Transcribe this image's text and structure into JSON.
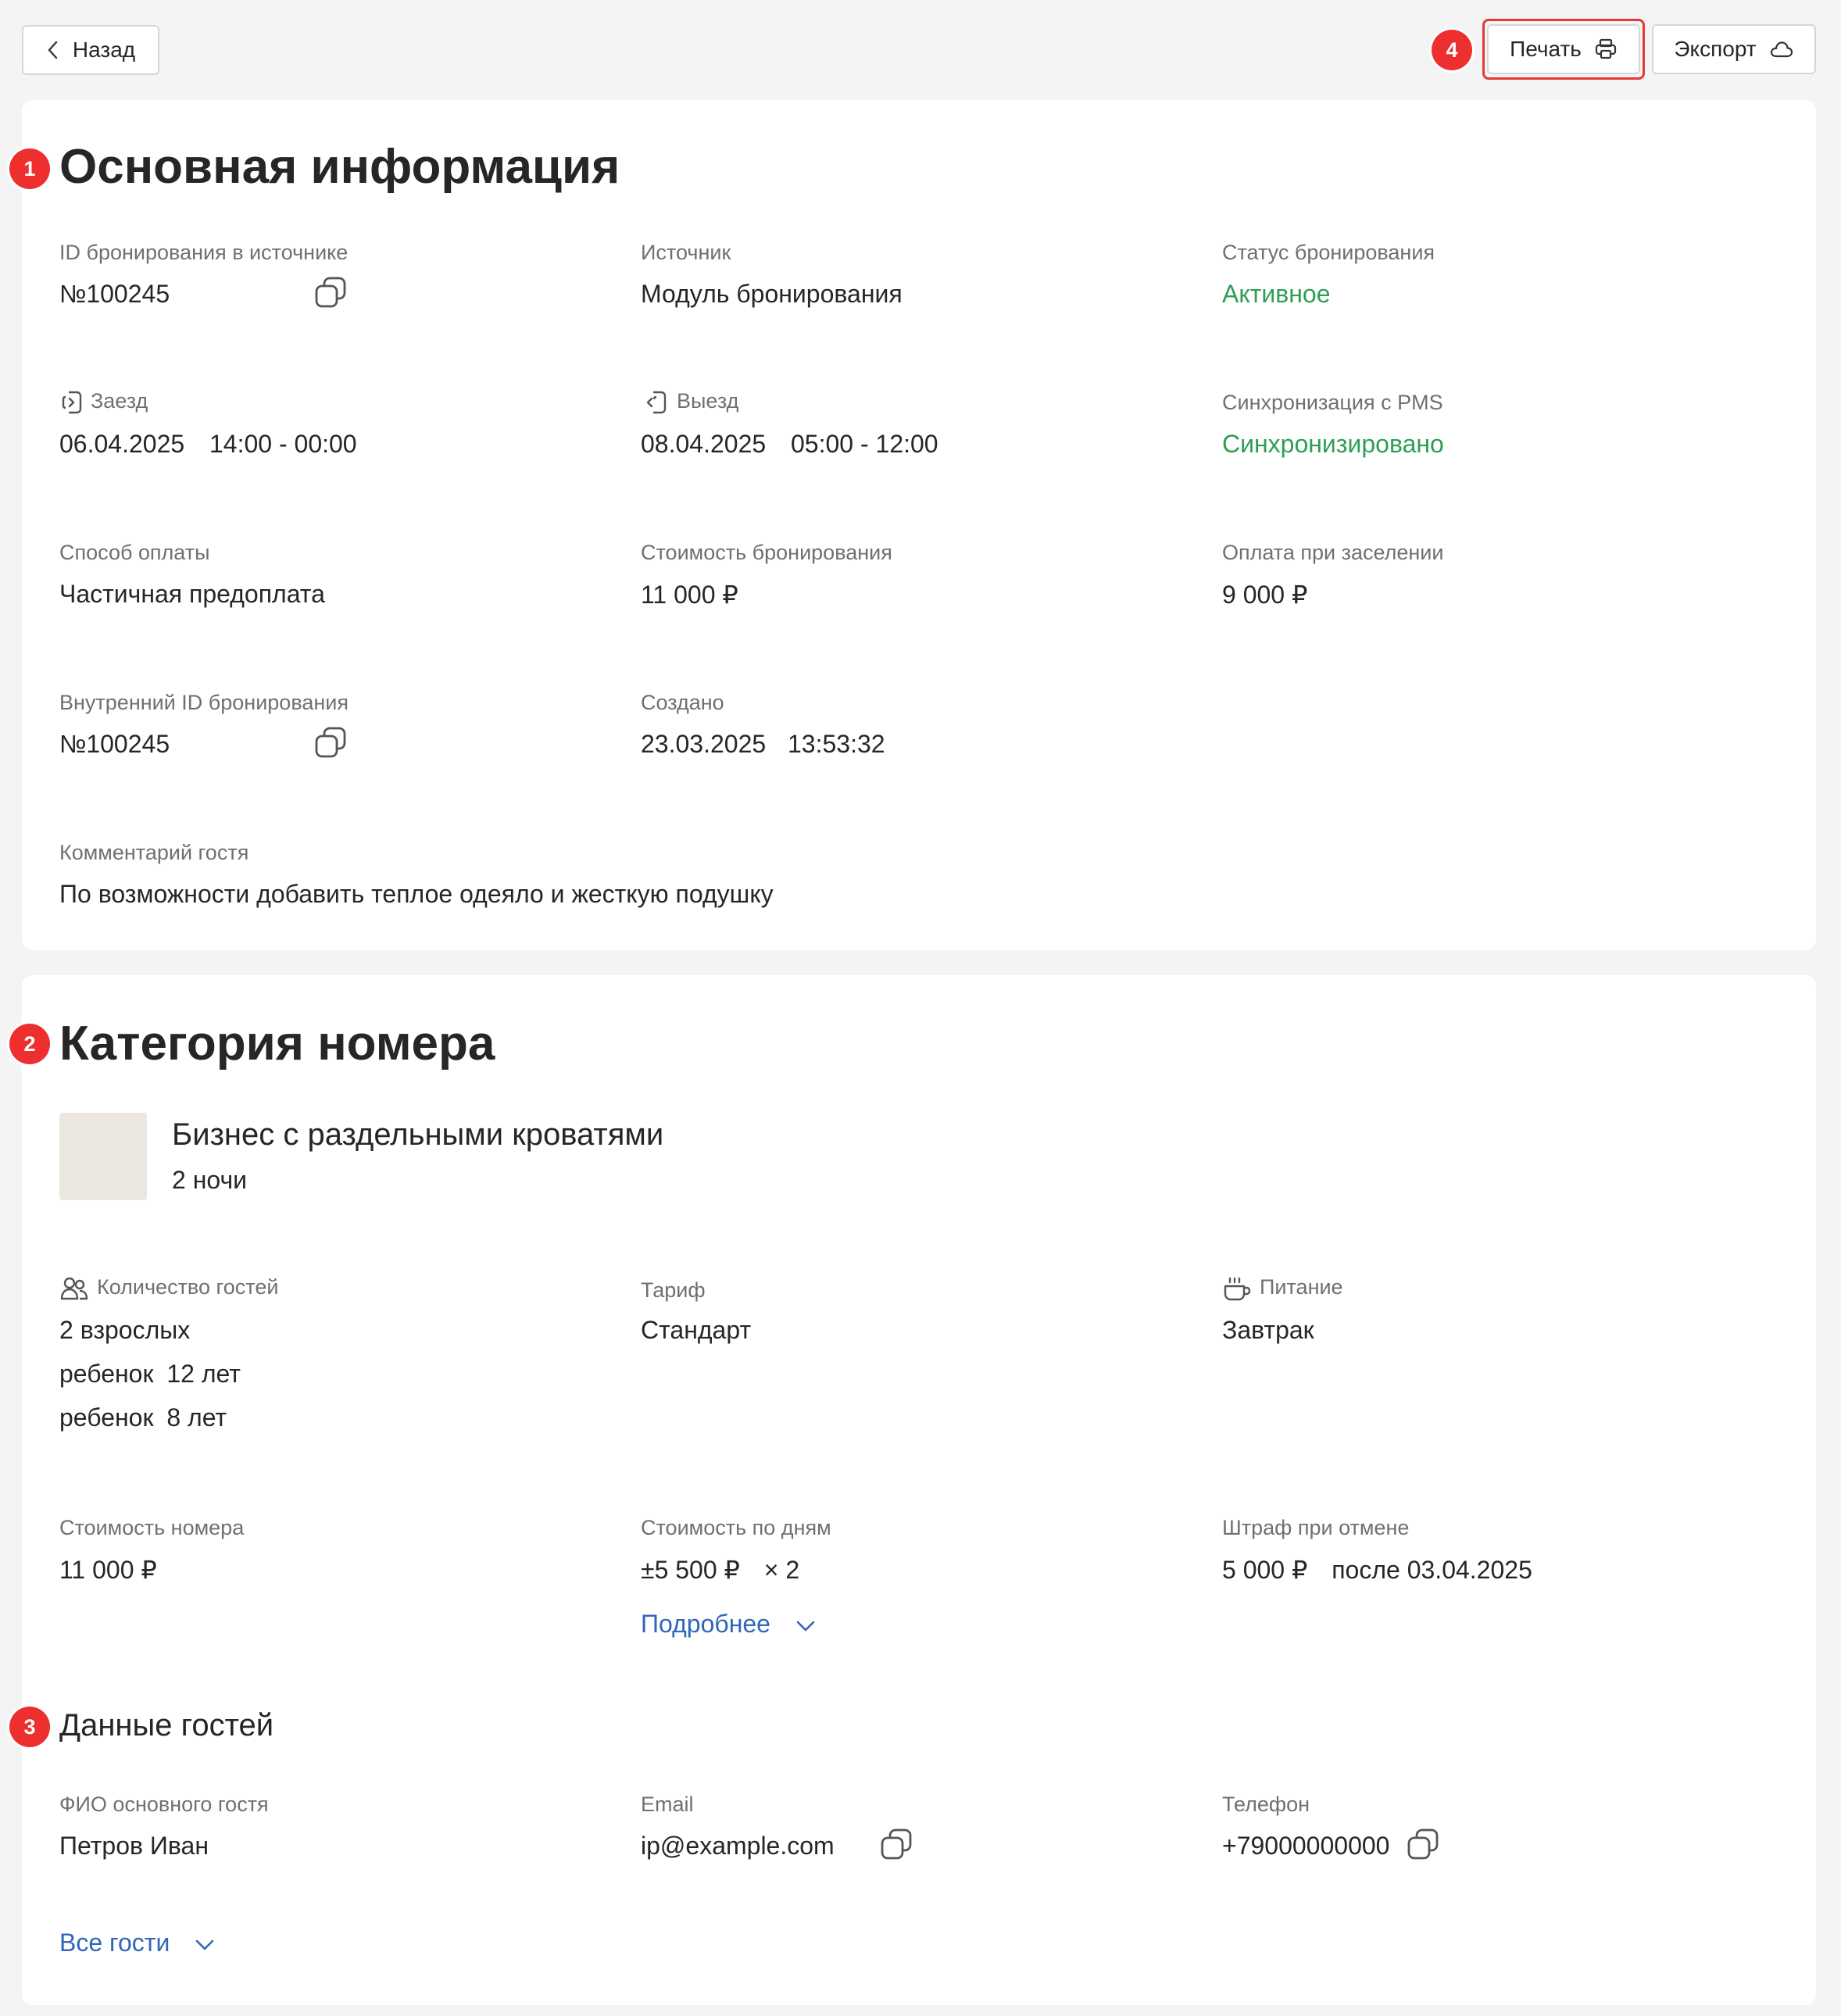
{
  "toolbar": {
    "back_label": "Назад",
    "print_label": "Печать",
    "export_label": "Экспорт",
    "highlight_color": "#e53935"
  },
  "markers": [
    "1",
    "2",
    "3",
    "4"
  ],
  "main_info": {
    "title": "Основная информация",
    "source_id_label": "ID бронирования в источнике",
    "source_id_value": "№100245",
    "source_label": "Источник",
    "source_value": "Модуль бронирования",
    "status_label": "Статус бронирования",
    "status_value": "Активное",
    "checkin_label": "Заезд",
    "checkin_date": "06.04.2025",
    "checkin_time": "14:00 - 00:00",
    "checkout_label": "Выезд",
    "checkout_date": "08.04.2025",
    "checkout_time": "05:00 - 12:00",
    "pms_label": "Синхронизация с PMS",
    "pms_value": "Синхронизировано",
    "payment_method_label": "Способ оплаты",
    "payment_method_value": "Частичная предоплата",
    "booking_cost_label": "Стоимость бронирования",
    "booking_cost_value": "11 000 ₽",
    "pay_on_arrival_label": "Оплата при заселении",
    "pay_on_arrival_value": "9 000 ₽",
    "internal_id_label": "Внутренний ID бронирования",
    "internal_id_value": "№100245",
    "created_label": "Создано",
    "created_date": "23.03.2025",
    "created_time": "13:53:32",
    "comment_label": "Комментарий гостя",
    "comment_value": "По возможности добавить теплое одеяло и жесткую подушку",
    "status_color": "#2f9e54"
  },
  "room": {
    "title": "Категория номера",
    "name": "Бизнес с раздельными кроватями",
    "nights": "2 ночи",
    "guests_label": "Количество гостей",
    "adults": "2 взрослых",
    "children": [
      {
        "label": "ребенок",
        "age": "12 лет"
      },
      {
        "label": "ребенок",
        "age": "8 лет"
      }
    ],
    "tariff_label": "Тариф",
    "tariff_value": "Стандарт",
    "meal_label": "Питание",
    "meal_value": "Завтрак",
    "room_cost_label": "Стоимость номера",
    "room_cost_value": "11 000 ₽",
    "daily_cost_label": "Стоимость по дням",
    "daily_cost_value": "±5 500 ₽",
    "daily_multiplier": "× 2",
    "more_link": "Подробнее",
    "penalty_label": "Штраф при отмене",
    "penalty_value": "5 000 ₽",
    "penalty_after": "после 03.04.2025"
  },
  "guests": {
    "title": "Данные гостей",
    "name_label": "ФИО основного гостя",
    "name_value": "Петров Иван",
    "email_label": "Email",
    "email_value": "ip@example.com",
    "phone_label": "Телефон",
    "phone_value": "+79000000000",
    "all_guests_link": "Все гости"
  }
}
